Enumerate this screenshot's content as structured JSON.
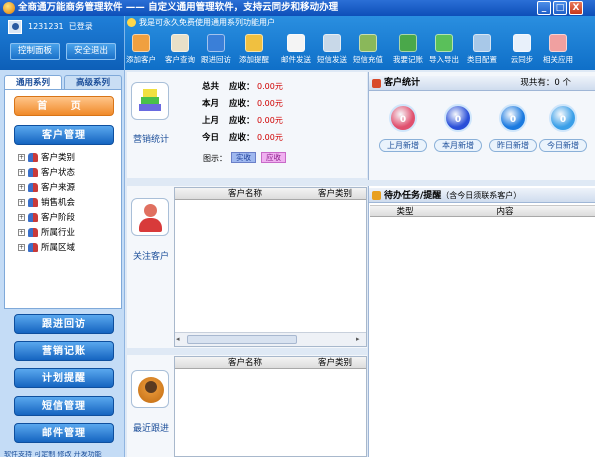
{
  "window": {
    "title": "全商通万能商务管理软件 —— 自定义通用管理软件，支持云同步和移动办理",
    "controls": [
      "_",
      "□",
      "X"
    ]
  },
  "user": {
    "id": "1231231",
    "status": "已登录",
    "buttons": {
      "dashboard": "控制面板",
      "logout": "安全退出"
    }
  },
  "notice": "我是可永久免费使用通用系列功能用户",
  "toolbar": [
    {
      "label": "添加客户",
      "icon": "add-customer-icon",
      "color": "#f0a040"
    },
    {
      "label": "客户查询",
      "icon": "customer-search-icon",
      "color": "#e8e0c8"
    },
    {
      "label": "跟进回访",
      "icon": "followup-icon",
      "color": "#3a7fd8"
    },
    {
      "label": "添加提醒",
      "icon": "alarm-clock-icon",
      "color": "#f0c040"
    },
    {
      "label": "邮件发送",
      "icon": "mail-icon",
      "color": "#f4f4f4"
    },
    {
      "label": "短信发送",
      "icon": "phone-icon",
      "color": "#c8d8e8"
    },
    {
      "label": "短信充值",
      "icon": "sms-recharge-icon",
      "color": "#8ab85a"
    },
    {
      "label": "我要记账",
      "icon": "money-icon",
      "color": "#4aa84a"
    },
    {
      "label": "导入导出",
      "icon": "import-export-icon",
      "color": "#5ac05a"
    },
    {
      "label": "类目配置",
      "icon": "category-config-icon",
      "color": "#a8c8e8"
    },
    {
      "label": "云同步",
      "icon": "cloud-sync-icon",
      "color": "#e8f0fa"
    },
    {
      "label": "相关应用",
      "icon": "apps-icon",
      "color": "#f0a0a0"
    }
  ],
  "nav": {
    "tabs": [
      "通用系列",
      "高级系列"
    ],
    "home": "首 页",
    "customer_mgmt": "客户管理",
    "tree": [
      "客户类别",
      "客户状态",
      "客户来源",
      "销售机会",
      "客户阶段",
      "所属行业",
      "所属区域"
    ],
    "buttons": [
      "跟进回访",
      "营销记账",
      "计划提醒",
      "短信管理",
      "邮件管理"
    ],
    "footer_cut": "软件支持 可定制 修改 开发功能"
  },
  "sales": {
    "label": "营销统计",
    "rows": [
      {
        "period": "总共",
        "kind": "应收：",
        "value": "0.00元"
      },
      {
        "period": "本月",
        "kind": "应收：",
        "value": "0.00元"
      },
      {
        "period": "上月",
        "kind": "应收：",
        "value": "0.00元"
      },
      {
        "period": "今日",
        "kind": "应收：",
        "value": "0.00元"
      }
    ],
    "legend_label": "图示：",
    "legend": [
      {
        "name": "实收",
        "color": "#9fb8ef"
      },
      {
        "name": "应收",
        "color": "#f0b0f0"
      }
    ]
  },
  "attention": {
    "label": "关注客户",
    "columns": [
      "客户名称",
      "客户类别"
    ]
  },
  "recent": {
    "label": "最近跟进",
    "columns": [
      "客户名称",
      "客户类别"
    ]
  },
  "customer_stats": {
    "title": "客户统计",
    "current": "现共有：0 个",
    "items": [
      {
        "value": "0",
        "label": "上月新增",
        "color": "#e0506e"
      },
      {
        "value": "0",
        "label": "本月新增",
        "color": "#2a4fd8"
      },
      {
        "value": "0",
        "label": "昨日新增",
        "color": "#1a7ae0"
      },
      {
        "value": "0",
        "label": "今日新增",
        "color": "#3a9fe8"
      }
    ]
  },
  "todo": {
    "title": "待办任务/提醒",
    "subtitle": "（含今日须联系客户）",
    "columns": [
      "类型",
      "内容"
    ]
  }
}
